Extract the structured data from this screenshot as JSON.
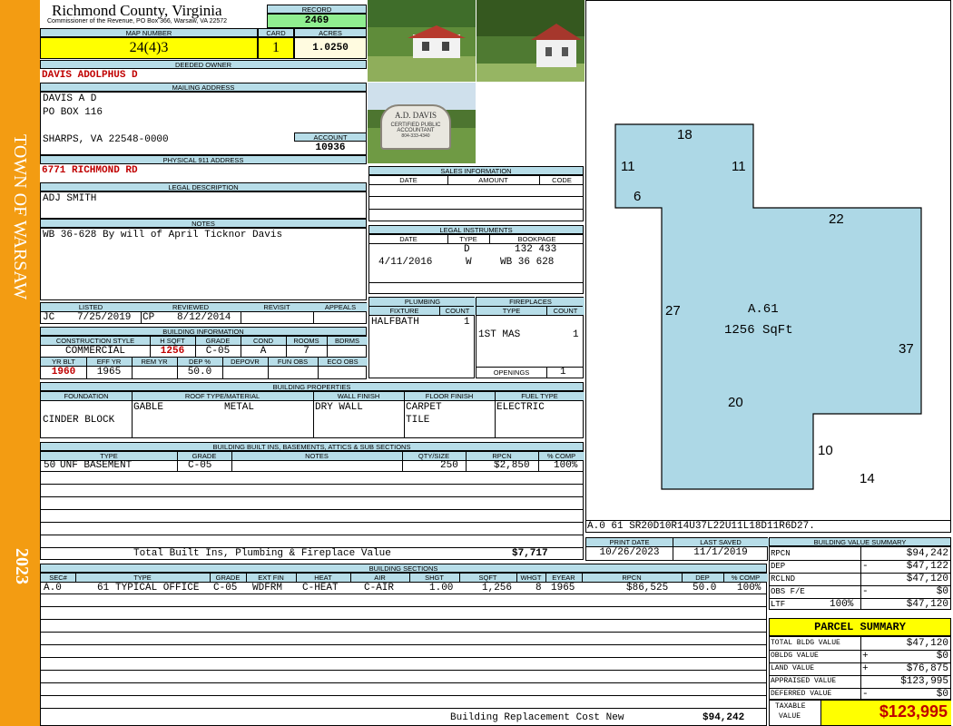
{
  "sidebar": {
    "town": "TOWN OF WARSAW",
    "year": "2023"
  },
  "county": {
    "title": "Richmond County, Virginia",
    "subtitle": "Commissioner of the Revenue, PO Box 366, Warsaw, VA 22572"
  },
  "record": {
    "label": "RECORD",
    "value": "2469"
  },
  "map": {
    "label": "MAP NUMBER",
    "value": "24(4)3",
    "card_label": "CARD",
    "card": "1",
    "acres_label": "ACRES",
    "acres": "1.0250"
  },
  "owner": {
    "label": "DEEDED OWNER",
    "name": "DAVIS ADOLPHUS D"
  },
  "mailing": {
    "label": "MAILING ADDRESS",
    "line1": "DAVIS A D",
    "line2": "PO BOX 116",
    "line3": "SHARPS, VA 22548-0000"
  },
  "account": {
    "label": "ACCOUNT",
    "value": "10936"
  },
  "physical": {
    "label": "PHYSICAL 911 ADDRESS",
    "value": "6771 RICHMOND RD"
  },
  "legal": {
    "label": "LEGAL DESCRIPTION",
    "value": "ADJ SMITH"
  },
  "notes": {
    "label": "NOTES",
    "value": "WB 36-628 By will of April Ticknor Davis"
  },
  "photo": {
    "sign_line1": "A.D. DAVIS",
    "sign_line2": "CERTIFIED PUBLIC",
    "sign_line3": "ACCOUNTANT",
    "sign_line4": "804-333-4340"
  },
  "sales": {
    "label": "SALES INFORMATION",
    "col_date": "DATE",
    "col_amount": "AMOUNT",
    "col_code": "CODE"
  },
  "legal_instr": {
    "label": "LEGAL INSTRUMENTS",
    "col_date": "DATE",
    "col_type": "TYPE",
    "col_bookpage": "BOOKPAGE",
    "rows": [
      {
        "date": "",
        "type": "D",
        "bookpage": "132 433"
      },
      {
        "date": "4/11/2016",
        "type": "W",
        "bookpage": "WB 36 628"
      }
    ]
  },
  "listed": {
    "listed_label": "LISTED",
    "reviewed_label": "REVIEWED",
    "revisit_label": "REVISIT",
    "appeals_label": "APPEALS",
    "listed_by": "JC",
    "listed_date": "7/25/2019",
    "reviewed_by": "CP",
    "reviewed_date": "8/12/2014"
  },
  "bldg_info": {
    "label": "BUILDING INFORMATION",
    "h_const": "CONSTRUCTION STYLE",
    "h_sqft": "H SQFT",
    "h_grade": "GRADE",
    "h_cond": "COND",
    "h_rooms": "ROOMS",
    "h_bdrms": "BDRMS",
    "const": "COMMERCIAL",
    "sqft": "1256",
    "grade": "C-05",
    "cond": "A",
    "rooms": "7",
    "bdrms": "",
    "h_yrblt": "YR BLT",
    "h_effyr": "EFF YR",
    "h_remyr": "REM YR",
    "h_dep": "DEP %",
    "h_depovr": "DEPOVR",
    "h_funobs": "FUN OBS",
    "h_ecoobs": "ECO OBS",
    "yrblt": "1960",
    "effyr": "1965",
    "remyr": "",
    "dep": "50.0"
  },
  "plumbing": {
    "label": "PLUMBING",
    "h_fixture": "FIXTURE",
    "h_count": "COUNT",
    "fixture": "HALFBATH",
    "count": "1"
  },
  "fireplaces": {
    "label": "FIREPLACES",
    "h_type": "TYPE",
    "h_count": "COUNT",
    "type": "1ST MAS",
    "count": "1",
    "openings_label": "OPENINGS",
    "openings": "1"
  },
  "bldg_props": {
    "label": "BUILDING PROPERTIES",
    "h_foundation": "FOUNDATION",
    "h_roof": "ROOF TYPE/MATERIAL",
    "h_wall": "WALL FINISH",
    "h_floor": "FLOOR FINISH",
    "h_fuel": "FUEL TYPE",
    "foundation": "CINDER BLOCK",
    "roof_type": "GABLE",
    "roof_mat": "METAL",
    "wall": "DRY WALL",
    "floor1": "CARPET",
    "floor2": "TILE",
    "fuel": "ELECTRIC"
  },
  "builtins": {
    "label": "BUILDING BUILT INS, BASEMENTS, ATTICS & SUB SECTIONS",
    "h_type": "TYPE",
    "h_grade": "GRADE",
    "h_notes": "NOTES",
    "h_qty": "QTY/SIZE",
    "h_rpcn": "RPCN",
    "h_comp": "% COMP",
    "row_code": "50",
    "row_type": "UNF BASEMENT",
    "row_grade": "C-05",
    "row_qty": "250",
    "row_rpcn": "$2,850",
    "row_comp": "100%",
    "total_label": "Total Built Ins, Plumbing & Fireplace Value",
    "total": "$7,717"
  },
  "sketch": {
    "area_label": "A.61",
    "area_sqft": "1256 SqFt",
    "code": "A.0  61   SR20D10R14U37L22U11L18D11R6D27.",
    "dims": {
      "top": "18",
      "left_top": "11",
      "right_top": "11",
      "step": "6",
      "mid_top": "22",
      "left": "27",
      "right": "37",
      "bottom_mid": "20",
      "lower_left": "10",
      "bottom": "14"
    }
  },
  "print": {
    "print_label": "PRINT DATE",
    "saved_label": "LAST SAVED",
    "print_date": "10/26/2023",
    "saved_date": "11/1/2019"
  },
  "sections": {
    "label": "BUILDING SECTIONS",
    "h_sec": "SEC#",
    "h_type": "TYPE",
    "h_grade": "GRADE",
    "h_extfin": "EXT FIN",
    "h_heat": "HEAT",
    "h_air": "AIR",
    "h_shgt": "SHGT",
    "h_sqft": "SQFT",
    "h_whgt": "WHGT",
    "h_eyear": "EYEAR",
    "h_rpcn": "RPCN",
    "h_dep": "DEP",
    "h_comp": "% COMP",
    "sec": "A.0",
    "code": "61",
    "type": "TYPICAL OFFICE",
    "grade": "C-05",
    "extfin": "WDFRM",
    "heat": "C-HEAT",
    "air": "C-AIR",
    "shgt": "1.00",
    "sqft": "1,256",
    "whgt": "8",
    "eyear": "1965",
    "rpcn": "$86,525",
    "dep": "50.0",
    "comp": "100%",
    "brcn_label": "Building Replacement Cost New",
    "brcn": "$94,242"
  },
  "value_summary": {
    "label": "BUILDING VALUE SUMMARY",
    "rows": [
      {
        "label": "RPCN",
        "sign": "",
        "value": "$94,242"
      },
      {
        "label": "DEP",
        "sign": "-",
        "value": "$47,122"
      },
      {
        "label": "RCLND",
        "sign": "",
        "value": "$47,120"
      },
      {
        "label": "OBS F/E",
        "sign": "-",
        "value": "$0"
      },
      {
        "label": "LTF",
        "sign": "100%",
        "value": "$47,120"
      }
    ]
  },
  "parcel": {
    "label": "PARCEL SUMMARY",
    "rows": [
      {
        "label": "TOTAL BLDG VALUE",
        "sign": "",
        "value": "$47,120"
      },
      {
        "label": "OBLDG VALUE",
        "sign": "+",
        "value": "$0"
      },
      {
        "label": "LAND VALUE",
        "sign": "+",
        "value": "$76,875"
      },
      {
        "label": "APPRAISED VALUE",
        "sign": "",
        "value": "$123,995"
      },
      {
        "label": "DEFERRED VALUE",
        "sign": "-",
        "value": "$0"
      }
    ],
    "taxable_label1": "TAXABLE",
    "taxable_label2": "VALUE",
    "taxable": "$123,995"
  }
}
